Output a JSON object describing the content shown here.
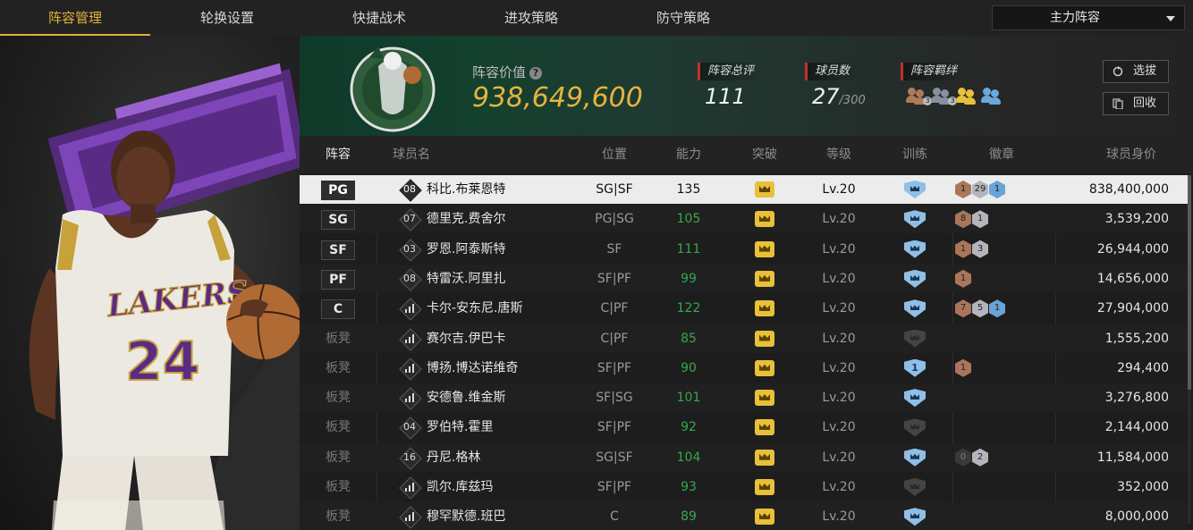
{
  "nav": {
    "tabs": [
      "阵容管理",
      "轮换设置",
      "快捷战术",
      "进攻策略",
      "防守策略"
    ],
    "active": 0,
    "lineup_select": "主力阵容"
  },
  "summary": {
    "value_label": "阵容价值",
    "value": "938,649,600",
    "rating_label": "阵容总评",
    "rating": "111",
    "players_label": "球员数",
    "players": "27",
    "players_max": "/300",
    "bond_label": "阵容羁绊",
    "bonds": [
      {
        "color": "#b07a58",
        "level": "3"
      },
      {
        "color": "#8a8fa0",
        "level": "3"
      },
      {
        "color": "#e8c03a",
        "level": ""
      },
      {
        "color": "#6aa8dc",
        "level": ""
      }
    ],
    "btn_scout": "选拔",
    "btn_recycle": "回收"
  },
  "table": {
    "headers": {
      "lineup": "阵容",
      "name": "球员名",
      "position": "位置",
      "ability": "能力",
      "breakthrough": "突破",
      "level": "等级",
      "training": "训练",
      "badges": "徽章",
      "value": "球员身价"
    },
    "rows": [
      {
        "slot": "PG",
        "starter": true,
        "jersey": "08",
        "name": "科比.布莱恩特",
        "pos": "SG|SF",
        "ability": "135",
        "level": "Lv.20",
        "train": "on",
        "badges": [
          {
            "c": "#a9765a",
            "n": "1"
          },
          {
            "c": "#b4b4bc",
            "n": "29"
          },
          {
            "c": "#6aa3d8",
            "n": "1"
          }
        ],
        "value": "838,400,000"
      },
      {
        "slot": "SG",
        "starter": true,
        "jersey": "07",
        "name": "德里克.费舍尔",
        "pos": "PG|SG",
        "ability": "105",
        "level": "Lv.20",
        "train": "on",
        "badges": [
          {
            "c": "#a9765a",
            "n": "8"
          },
          {
            "c": "#b4b4bc",
            "n": "1"
          }
        ],
        "value": "3,539,200"
      },
      {
        "slot": "SF",
        "starter": true,
        "jersey": "03",
        "name": "罗恩.阿泰斯特",
        "pos": "SF",
        "ability": "111",
        "level": "Lv.20",
        "train": "on",
        "badges": [
          {
            "c": "#a9765a",
            "n": "1"
          },
          {
            "c": "#b4b4bc",
            "n": "3"
          }
        ],
        "value": "26,944,000"
      },
      {
        "slot": "PF",
        "starter": true,
        "jersey": "08",
        "name": "特雷沃.阿里扎",
        "pos": "SF|PF",
        "ability": "99",
        "level": "Lv.20",
        "train": "on",
        "badges": [
          {
            "c": "#a9765a",
            "n": "1"
          }
        ],
        "value": "14,656,000"
      },
      {
        "slot": "C",
        "starter": true,
        "jersey": "",
        "name": "卡尔-安东尼.唐斯",
        "pos": "C|PF",
        "ability": "122",
        "level": "Lv.20",
        "train": "on",
        "badges": [
          {
            "c": "#a9765a",
            "n": "7"
          },
          {
            "c": "#b4b4bc",
            "n": "5"
          },
          {
            "c": "#6aa3d8",
            "n": "1"
          }
        ],
        "value": "27,904,000"
      },
      {
        "slot": "板凳",
        "starter": false,
        "jersey": "",
        "name": "赛尔吉.伊巴卡",
        "pos": "C|PF",
        "ability": "85",
        "level": "Lv.20",
        "train": "off",
        "badges": [],
        "value": "1,555,200"
      },
      {
        "slot": "板凳",
        "starter": false,
        "jersey": "",
        "name": "博扬.博达诺维奇",
        "pos": "SF|PF",
        "ability": "90",
        "level": "Lv.20",
        "train": "1",
        "badges": [
          {
            "c": "#a9765a",
            "n": "1"
          }
        ],
        "value": "294,400"
      },
      {
        "slot": "板凳",
        "starter": false,
        "jersey": "",
        "name": "安德鲁.维金斯",
        "pos": "SF|SG",
        "ability": "101",
        "level": "Lv.20",
        "train": "on",
        "badges": [],
        "value": "3,276,800"
      },
      {
        "slot": "板凳",
        "starter": false,
        "jersey": "04",
        "name": "罗伯特.霍里",
        "pos": "SF|PF",
        "ability": "92",
        "level": "Lv.20",
        "train": "off",
        "badges": [],
        "value": "2,144,000"
      },
      {
        "slot": "板凳",
        "starter": false,
        "jersey": "16",
        "name": "丹尼.格林",
        "pos": "SG|SF",
        "ability": "104",
        "level": "Lv.20",
        "train": "on",
        "badges": [
          {
            "c": "#3a3a3a",
            "n": "0"
          },
          {
            "c": "#b4b4bc",
            "n": "2"
          }
        ],
        "value": "11,584,000"
      },
      {
        "slot": "板凳",
        "starter": false,
        "jersey": "",
        "name": "凯尔.库兹玛",
        "pos": "SF|PF",
        "ability": "93",
        "level": "Lv.20",
        "train": "off",
        "badges": [],
        "value": "352,000"
      },
      {
        "slot": "板凳",
        "starter": false,
        "jersey": "",
        "name": "穆罕默德.班巴",
        "pos": "C",
        "ability": "89",
        "level": "Lv.20",
        "train": "on",
        "badges": [],
        "value": "8,000,000"
      }
    ]
  },
  "colors": {
    "accent": "#e2b13c",
    "ability_green": "#37a84a",
    "label_red": "#c0302b"
  }
}
